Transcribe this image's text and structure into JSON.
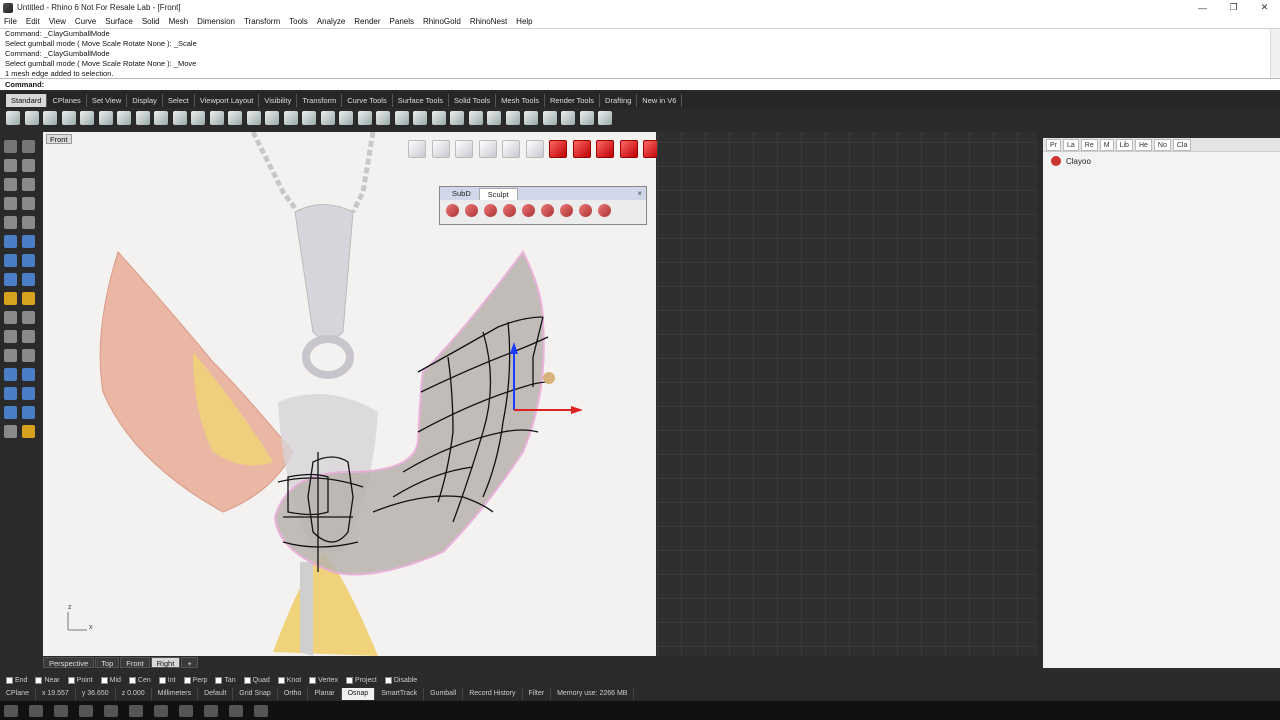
{
  "window": {
    "title": "Untitled - Rhino 6 Not For Resale Lab - [Front]",
    "minimize": "—",
    "restore": "❐",
    "close": "✕"
  },
  "menu": [
    "File",
    "Edit",
    "View",
    "Curve",
    "Surface",
    "Solid",
    "Mesh",
    "Dimension",
    "Transform",
    "Tools",
    "Analyze",
    "Render",
    "Panels",
    "RhinoGold",
    "RhinoNest",
    "Help"
  ],
  "command_history": [
    "Command: _ClayGumballMode",
    "Select gumball mode ( Move  Scale  Rotate  None ): _Scale",
    "Command: _ClayGumballMode",
    "Select gumball mode ( Move  Scale  Rotate  None ): _Move",
    "1 mesh edge added to selection."
  ],
  "command_line": {
    "label": "Command:",
    "value": ""
  },
  "toolbar_tabs": [
    "Standard",
    "CPlanes",
    "Set View",
    "Display",
    "Select",
    "Viewport Layout",
    "Visibility",
    "Transform",
    "Curve Tools",
    "Surface Tools",
    "Solid Tools",
    "Mesh Tools",
    "Render Tools",
    "Drafting",
    "New in V6"
  ],
  "active_toolbar_tab": "Standard",
  "viewport": {
    "name": "Front",
    "axis_z": "z",
    "axis_x": "x"
  },
  "floating_panel": {
    "tabs": [
      "SubD",
      "Sculpt"
    ],
    "active_tab": "Sculpt",
    "close": "×"
  },
  "right_panel": {
    "tabs": [
      "Pr",
      "La",
      "Re",
      "M",
      "Lib",
      "He",
      "No",
      "Cla"
    ],
    "item_label": "Clayoo"
  },
  "view_tabs": [
    "Perspective",
    "Top",
    "Front",
    "Right",
    "+"
  ],
  "active_view_tab": "Right",
  "osnaps": [
    {
      "label": "End",
      "on": false
    },
    {
      "label": "Near",
      "on": false
    },
    {
      "label": "Point",
      "on": true
    },
    {
      "label": "Mid",
      "on": true
    },
    {
      "label": "Cen",
      "on": false
    },
    {
      "label": "Int",
      "on": false
    },
    {
      "label": "Perp",
      "on": false
    },
    {
      "label": "Tan",
      "on": false
    },
    {
      "label": "Quad",
      "on": false
    },
    {
      "label": "Knot",
      "on": false
    },
    {
      "label": "Vertex",
      "on": false
    },
    {
      "label": "Project",
      "on": false
    },
    {
      "label": "Disable",
      "on": false
    }
  ],
  "status": {
    "cplane": "CPlane",
    "x": "x 19.557",
    "y": "y 36.650",
    "z": "z 0.000",
    "units": "Millimeters",
    "layer": "Default",
    "toggles": [
      "Grid Snap",
      "Ortho",
      "Planar",
      "Osnap",
      "SmartTrack",
      "Gumball",
      "Record History",
      "Filter"
    ],
    "active_toggle": "Osnap",
    "memory": "Memory use: 2266 MB"
  },
  "colors": {
    "accent_red": "#dd2222",
    "gumball_blue": "#1a3cff",
    "viewport_bg": "#f4f2f0",
    "dark_ui": "#2a2a2a"
  }
}
